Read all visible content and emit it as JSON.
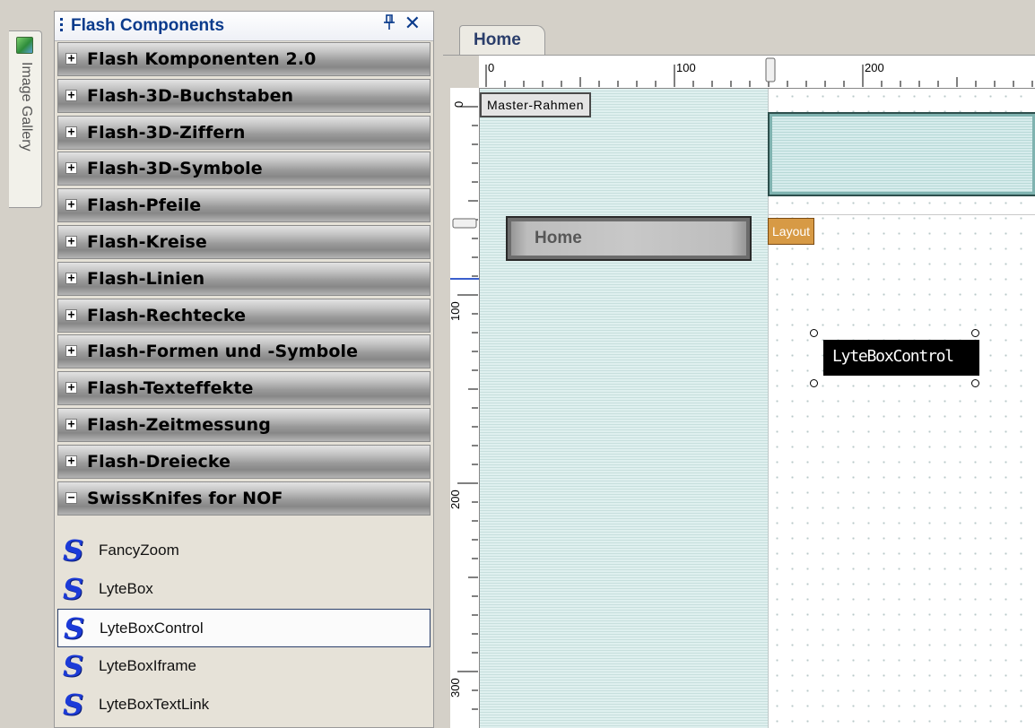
{
  "gallery": {
    "label": "Image Gallery"
  },
  "panel": {
    "title": "Flash Components",
    "pin_glyph": "p",
    "close_glyph": "✕",
    "groups": [
      {
        "label": "Flash Komponenten 2.0",
        "toggle": "+"
      },
      {
        "label": "Flash-3D-Buchstaben",
        "toggle": "+"
      },
      {
        "label": "Flash-3D-Ziffern",
        "toggle": "+"
      },
      {
        "label": "Flash-3D-Symbole",
        "toggle": "+"
      },
      {
        "label": "Flash-Pfeile",
        "toggle": "+"
      },
      {
        "label": "Flash-Kreise",
        "toggle": "+"
      },
      {
        "label": "Flash-Linien",
        "toggle": "+"
      },
      {
        "label": "Flash-Rechtecke",
        "toggle": "+"
      },
      {
        "label": "Flash-Formen und -Symbole",
        "toggle": "+"
      },
      {
        "label": "Flash-Texteffekte",
        "toggle": "+"
      },
      {
        "label": "Flash-Zeitmessung",
        "toggle": "+"
      },
      {
        "label": "Flash-Dreiecke",
        "toggle": "+"
      },
      {
        "label": "SwissKnifes for NOF",
        "toggle": "−"
      }
    ],
    "items": [
      {
        "label": "FancyZoom",
        "icon": "S",
        "selected": false
      },
      {
        "label": "LyteBox",
        "icon": "S",
        "selected": false
      },
      {
        "label": "LyteBoxControl",
        "icon": "S",
        "selected": true
      },
      {
        "label": "LyteBoxIframe",
        "icon": "S",
        "selected": false
      },
      {
        "label": "LyteBoxTextLink",
        "icon": "S",
        "selected": false
      }
    ]
  },
  "document": {
    "tab_label": "Home",
    "ruler_h": [
      "0",
      "100",
      "200"
    ],
    "ruler_v": [
      "0",
      "100",
      "200",
      "300"
    ],
    "master_label": "Master-Rahmen",
    "layout_label": "Layout",
    "home_button_label": "Home",
    "selected_component_label": "LyteBoxControl"
  },
  "colors": {
    "title_text": "#0b3b8c",
    "item_icon": "#1c3bd8",
    "layout_badge": "#d79a45"
  }
}
